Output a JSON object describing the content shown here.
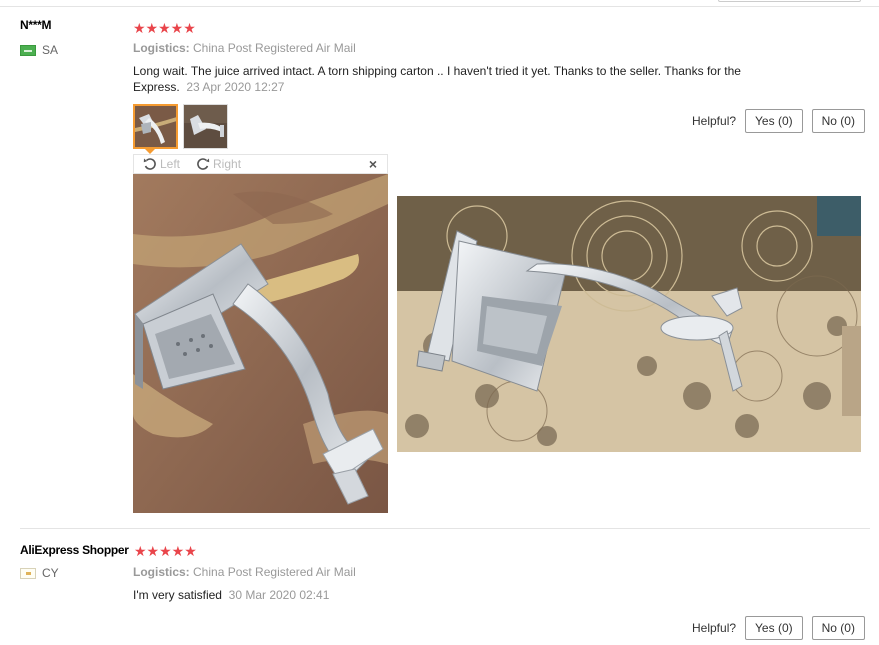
{
  "reviews": [
    {
      "user": "N***M",
      "country": "SA",
      "rating": 5,
      "stars": "★★★★★",
      "logistics_label": "Logistics:",
      "logistics_value": "China Post Registered Air Mail",
      "text_line1": "Long wait. The juice arrived intact. A torn shipping carton .. I haven't tried it yet. Thanks to the seller. Thanks for the",
      "text_line2": "Express.",
      "date": "23 Apr 2020 12:27",
      "photo_count": 2,
      "viewer": {
        "rotate_left": "Left",
        "rotate_right": "Right",
        "close": "×"
      },
      "helpful_label": "Helpful?",
      "yes_label": "Yes (0)",
      "no_label": "No (0)"
    },
    {
      "user": "AliExpress Shopper",
      "country": "CY",
      "rating": 5,
      "stars": "★★★★★",
      "logistics_label": "Logistics:",
      "logistics_value": "China Post Registered Air Mail",
      "text": "I'm very satisfied",
      "date": "30 Mar 2020 02:41",
      "helpful_label": "Helpful?",
      "yes_label": "Yes (0)",
      "no_label": "No (0)"
    }
  ],
  "colors": {
    "star": "#e9454b",
    "active_thumb": "#f59b31",
    "muted_text": "#999999"
  }
}
